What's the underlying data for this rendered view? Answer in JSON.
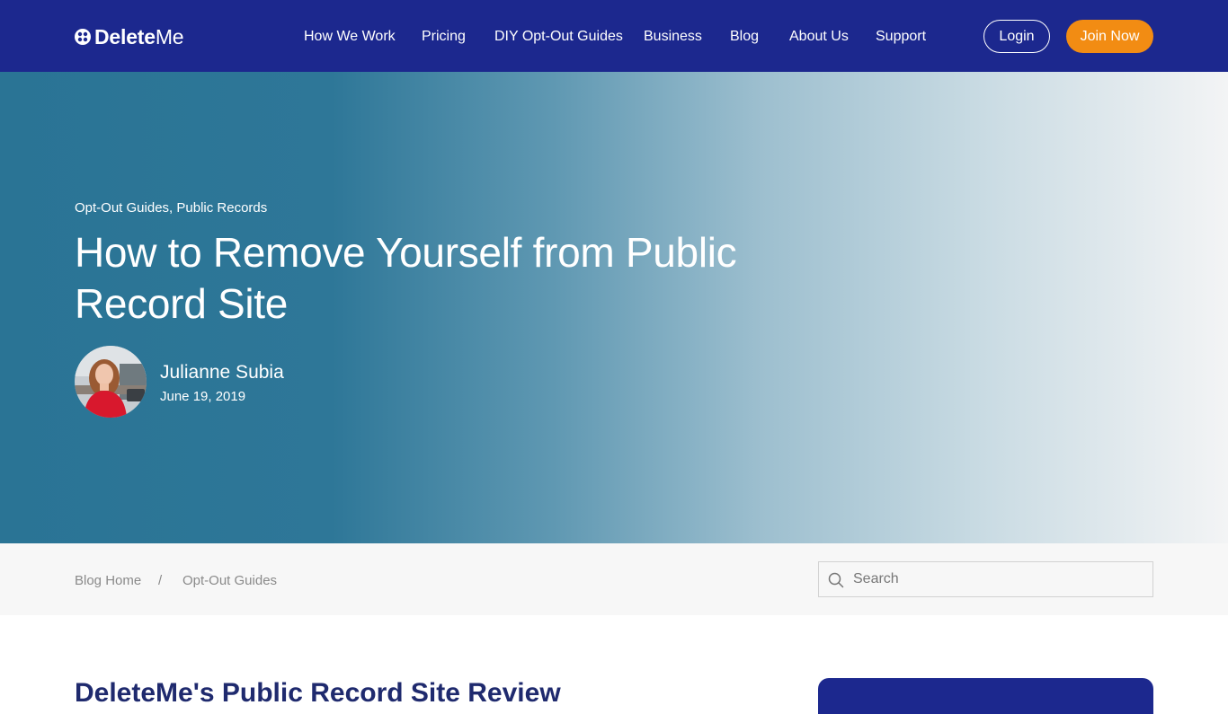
{
  "header": {
    "logo": {
      "bold": "Delete",
      "light": "Me"
    },
    "nav": [
      {
        "label": "How We Work"
      },
      {
        "label": "Pricing"
      },
      {
        "label": "DIY Opt-Out Guides"
      },
      {
        "label": "Business"
      },
      {
        "label": "Blog"
      },
      {
        "label": "About Us"
      },
      {
        "label": "Support"
      }
    ],
    "login_label": "Login",
    "join_label": "Join Now"
  },
  "hero": {
    "categories": "Opt-Out Guides, Public Records",
    "title": "How to Remove Yourself from Public Record Site",
    "author": "Julianne Subia",
    "date": "June 19, 2019"
  },
  "breadcrumb": {
    "items": [
      {
        "label": "Blog Home"
      },
      {
        "label": "/"
      },
      {
        "label": "Opt-Out Guides"
      }
    ]
  },
  "search": {
    "placeholder": "Search"
  },
  "article": {
    "heading": "DeleteMe's Public Record Site Review"
  },
  "colors": {
    "brand_navy": "#1c288e",
    "accent_orange": "#f28c13",
    "hero_start": "#2a7495",
    "hero_end": "#f3f4f5"
  },
  "icons": {
    "logo": "x-circle-logo-icon",
    "search": "search-icon"
  }
}
